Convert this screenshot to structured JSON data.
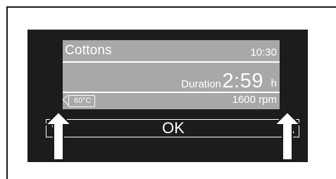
{
  "display": {
    "program": "Cottons",
    "clock": "10:30",
    "duration_label": "Duration",
    "duration_value": "2:59",
    "duration_unit": "h",
    "temperature": "60°C",
    "spin": "1600 rpm"
  },
  "buttons": {
    "ok_label": "OK",
    "down_icon": "chevron-down-icon",
    "up_icon": "chevron-up-icon"
  },
  "pointers": {
    "left_icon": "pointer-arrow-up-icon",
    "right_icon": "pointer-arrow-up-icon"
  },
  "colors": {
    "panel": "#1c1c1c",
    "screen": "#a8a8a8",
    "text": "#ffffff"
  }
}
